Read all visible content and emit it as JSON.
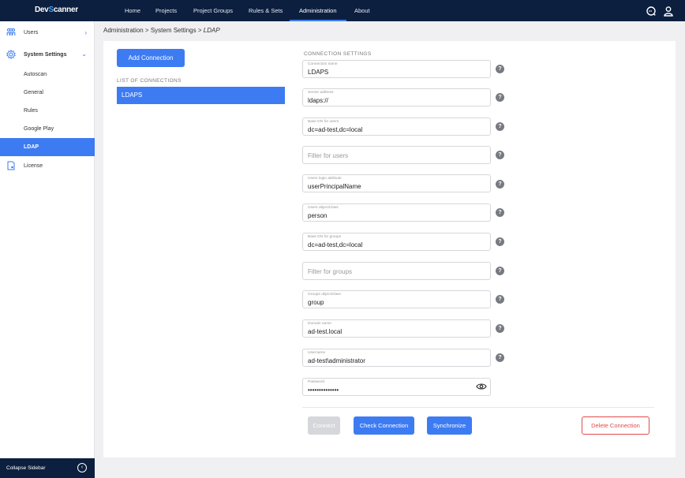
{
  "app": {
    "logo_left": "Dev",
    "logo_mid": "S",
    "logo_right": "canner"
  },
  "nav": {
    "items": [
      "Home",
      "Projects",
      "Project Groups",
      "Rules & Sets",
      "Administration",
      "About"
    ],
    "active": "Administration"
  },
  "sidebar": {
    "users": "Users",
    "system_settings": "System Settings",
    "sub_items": [
      "Autoscan",
      "General",
      "Rules",
      "Google Play",
      "LDAP"
    ],
    "license": "License",
    "collapse": "Collapse Sidebar",
    "active": "LDAP"
  },
  "breadcrumb": {
    "part1": "Administration",
    "sep": ">",
    "part2": "System Settings",
    "current": "LDAP"
  },
  "connections": {
    "add_button": "Add Connection",
    "list_title": "LIST OF CONNECTIONS",
    "items": [
      "LDAPS"
    ]
  },
  "settings": {
    "title": "CONNECTION SETTINGS",
    "fields": [
      {
        "label": "Connection name",
        "value": "LDAPS"
      },
      {
        "label": "Server address",
        "value": "ldaps://"
      },
      {
        "label": "Base DN for users",
        "value": "dc=ad-test,dc=local"
      },
      {
        "placeholder": "Filter for users"
      },
      {
        "label": "Users login attribute",
        "value": "userPrincipalName"
      },
      {
        "label": "Users objectClass",
        "value": "person"
      },
      {
        "label": "Base DN for groups",
        "value": "dc=ad-test,dc=local"
      },
      {
        "placeholder": "Filter for groups"
      },
      {
        "label": "Groups objectClass",
        "value": "group"
      },
      {
        "label": "Domain name",
        "value": "ad-test.local"
      },
      {
        "label": "Username",
        "value": "ad-test\\administrator"
      },
      {
        "label": "Password",
        "value": "••••••••••••••"
      }
    ],
    "help_glyph": "?"
  },
  "actions": {
    "connect": "Connect",
    "check": "Check Connection",
    "sync": "Synchronize",
    "delete": "Delete Connection"
  },
  "colors": {
    "topbar": "#0c1f3f",
    "accent": "#3d7bf3",
    "danger": "#e24a4a",
    "background": "#f0f0f2"
  }
}
